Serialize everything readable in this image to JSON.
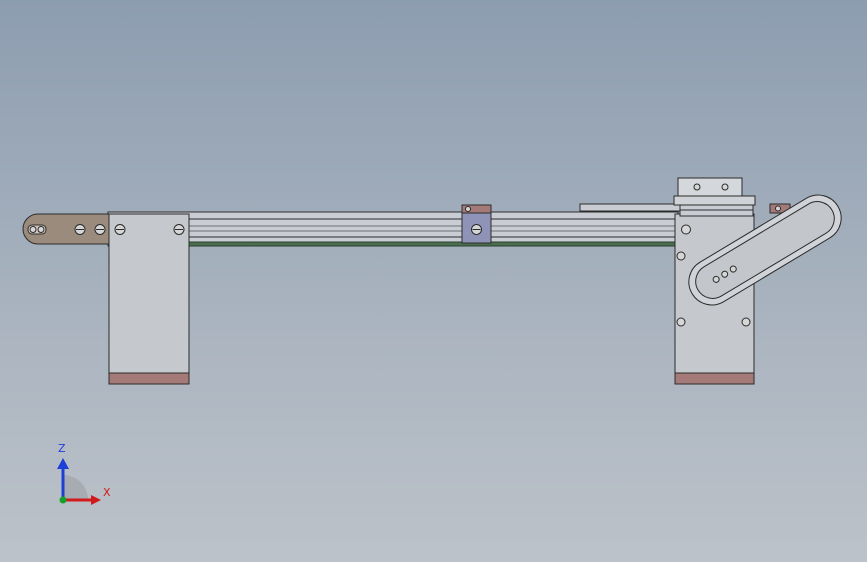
{
  "viewport": {
    "background_top": "#8d9db0",
    "background_bottom": "#bcc2c9"
  },
  "model": {
    "description_icon": "belt-conveyor-cad-model",
    "colors": {
      "rail": "#c9cdd3",
      "rail_dark": "#8b8f96",
      "support": "#c5c8cd",
      "foot_pad": "#a47a78",
      "end_plate": "#9b8b7d",
      "belt_green": "#4b6e4e",
      "bracket": "#8f93b8",
      "edge": "#2b2b2b"
    }
  },
  "triad": {
    "z_label": "Z",
    "x_label": "X",
    "z_color": "#1c3fd8",
    "x_color": "#d21a1a",
    "y_color": "#16a02a"
  }
}
